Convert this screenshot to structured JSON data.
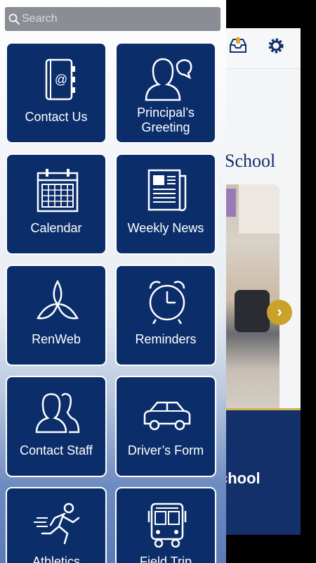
{
  "search": {
    "placeholder": "Search"
  },
  "background": {
    "school_title": "School",
    "bottom_title": "chool",
    "next_glyph": "›"
  },
  "tiles": [
    {
      "label": "Contact Us",
      "icon": "address-book-icon"
    },
    {
      "label": "Principal’s Greeting",
      "icon": "speaking-person-icon"
    },
    {
      "label": "Calendar",
      "icon": "calendar-icon"
    },
    {
      "label": "Weekly News",
      "icon": "newspaper-icon"
    },
    {
      "label": "RenWeb",
      "icon": "renweb-logo-icon"
    },
    {
      "label": "Reminders",
      "icon": "alarm-clock-icon"
    },
    {
      "label": "Contact Staff",
      "icon": "people-icon"
    },
    {
      "label": "Driver’s Form",
      "icon": "car-icon"
    },
    {
      "label": "Athletics",
      "icon": "runner-icon"
    },
    {
      "label": "Field Trip",
      "icon": "bus-icon"
    }
  ],
  "colors": {
    "tile": "#0b2e6b",
    "accent_gold": "#c9a227",
    "navy": "#14306b"
  }
}
